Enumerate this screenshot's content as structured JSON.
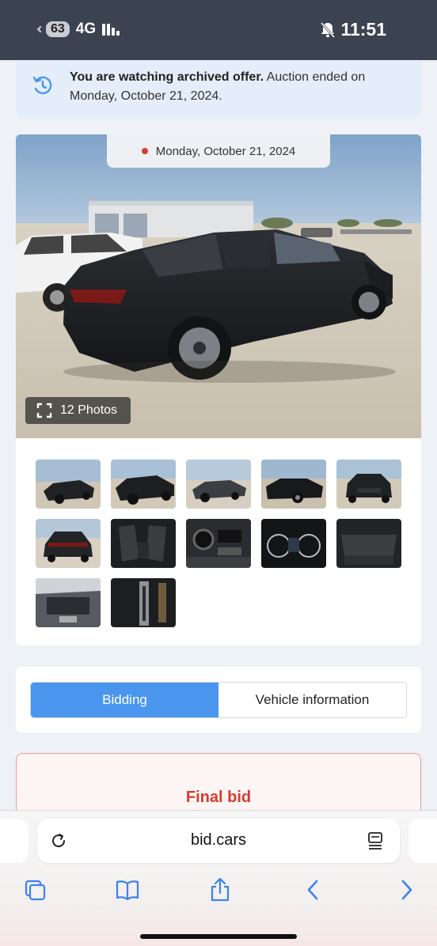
{
  "status_bar": {
    "battery": "63",
    "network": "4G",
    "time": "11:51",
    "icons": [
      "signal-icon",
      "bell-slash-icon"
    ]
  },
  "notice": {
    "bold_text": "You are watching archived offer.",
    "text": " Auction ended on Monday, October 21, 2024.",
    "icon": "history-icon"
  },
  "gallery": {
    "date": "Monday, October 21, 2024",
    "photos_label": "12 Photos",
    "thumbnails": [
      "rear-quarter-left",
      "rear-quarter-left-close",
      "rear-quarter-right",
      "front-quarter-right-damage",
      "front-view",
      "rear-view",
      "front-seats",
      "dashboard",
      "instrument-cluster",
      "rear-seats",
      "engine-bay",
      "vin-plate"
    ]
  },
  "tabs": {
    "items": [
      {
        "label": "Bidding",
        "active": true
      },
      {
        "label": "Vehicle information",
        "active": false
      }
    ]
  },
  "final_bid": {
    "label": "Final bid"
  },
  "browser": {
    "url": "bid.cars",
    "toolbar_icons": [
      "tabs-icon",
      "bookmarks-icon",
      "share-icon",
      "back-icon",
      "forward-icon"
    ]
  },
  "colors": {
    "accent": "#4a96ef",
    "final_bid_red": "#d83a2e",
    "status_bar_bg": "#3b4350",
    "notice_bg": "#e4eefb"
  }
}
